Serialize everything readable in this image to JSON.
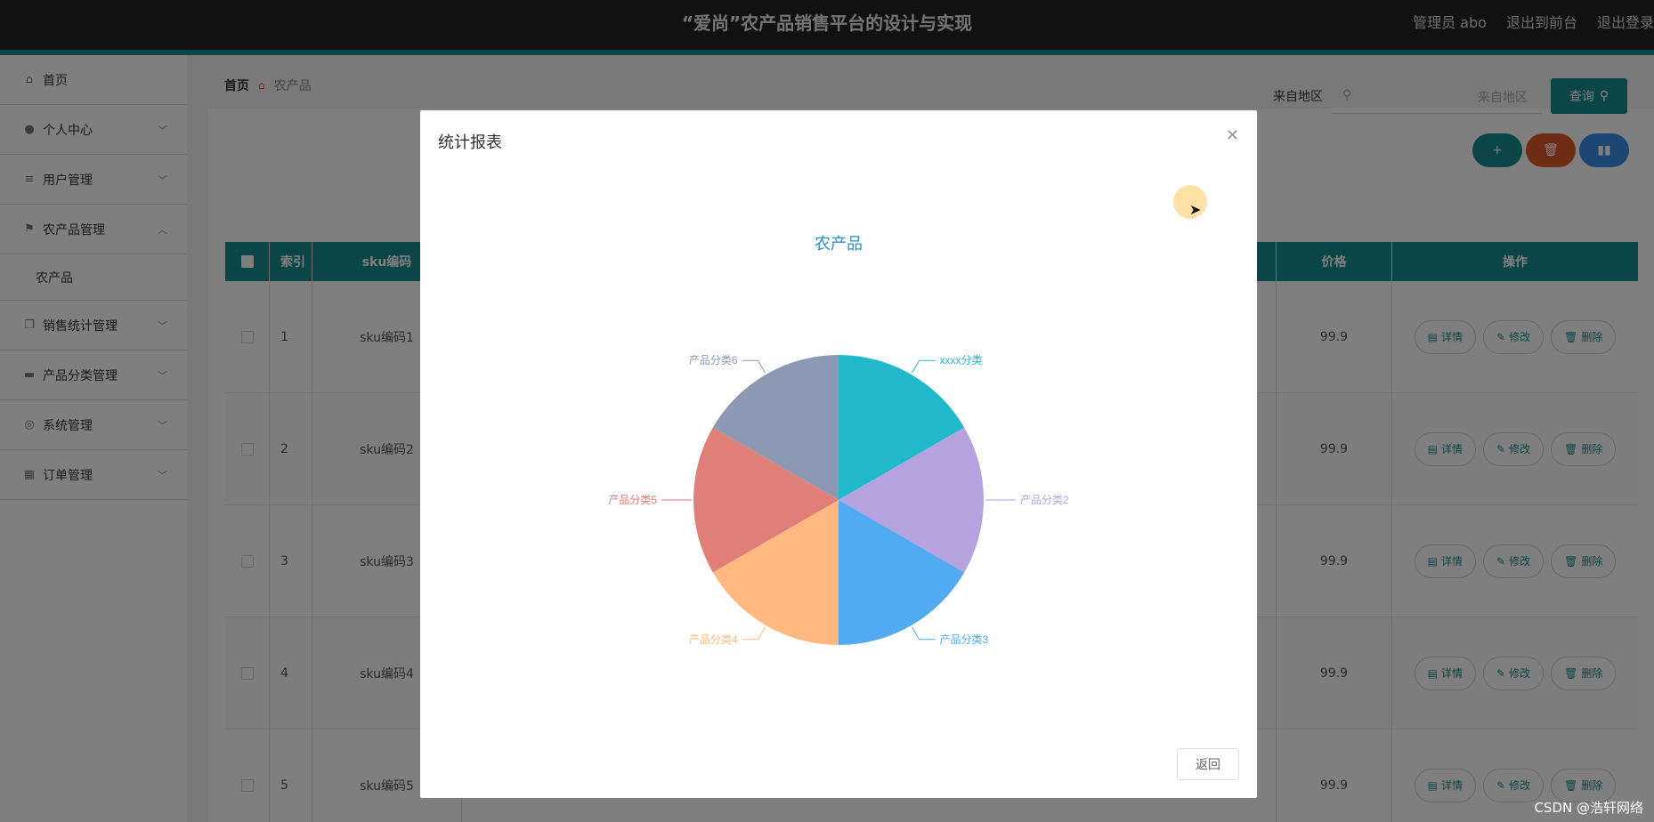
{
  "header": {
    "title": "“爱尚”农产品销售平台的设计与实现",
    "user": "管理员 abo",
    "to_front": "退出到前台",
    "logout": "退出登录"
  },
  "sidebar": {
    "items": [
      {
        "label": "首页",
        "icon": "home-icon"
      },
      {
        "label": "个人中心",
        "icon": "user-icon"
      },
      {
        "label": "用户管理",
        "icon": "list-icon"
      },
      {
        "label": "农产品管理",
        "icon": "flag-icon"
      },
      {
        "label": "农产品",
        "icon": ""
      },
      {
        "label": "销售统计管理",
        "icon": "copy-icon"
      },
      {
        "label": "产品分类管理",
        "icon": "monitor-icon"
      },
      {
        "label": "系统管理",
        "icon": "settings-icon"
      },
      {
        "label": "订单管理",
        "icon": "grid-icon"
      }
    ]
  },
  "breadcrumb": {
    "home": "首页",
    "current": "农产品"
  },
  "search": {
    "label": "来自地区",
    "placeholder": "来自地区",
    "button": "查询"
  },
  "table": {
    "headers": {
      "index": "索引",
      "sku": "sku编码",
      "price": "价格",
      "ops": "操作"
    },
    "rows": [
      {
        "index": "1",
        "sku": "sku编码1",
        "price": "99.9"
      },
      {
        "index": "2",
        "sku": "sku编码2",
        "price": "99.9"
      },
      {
        "index": "3",
        "sku": "sku编码3",
        "price": "99.9"
      },
      {
        "index": "4",
        "sku": "sku编码4",
        "price": "99.9"
      },
      {
        "index": "5",
        "sku": "sku编码5",
        "price": "99.9"
      }
    ],
    "op_labels": {
      "detail": "详情",
      "edit": "修改",
      "delete": "删除"
    }
  },
  "dialog": {
    "title": "统计报表",
    "back": "返回"
  },
  "chart_data": {
    "type": "pie",
    "title": "农产品",
    "categories": [
      "xxxx分类",
      "产品分类2",
      "产品分类3",
      "产品分类4",
      "产品分类5",
      "产品分类6"
    ],
    "values": [
      1,
      1,
      1,
      1,
      1,
      1
    ],
    "colors": [
      "#22b8cc",
      "#b6a2de",
      "#52aaf0",
      "#ffb980",
      "#e07e78",
      "#8d98b3"
    ]
  },
  "watermark": "CSDN @浩轩网络"
}
